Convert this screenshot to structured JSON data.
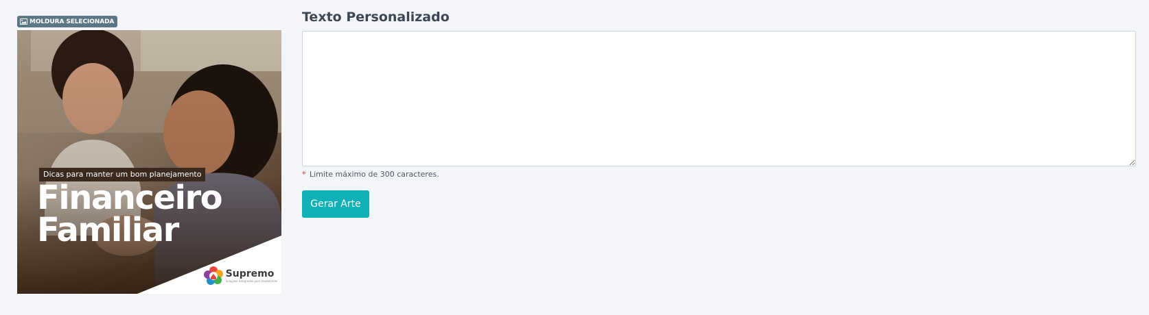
{
  "badge": {
    "label": "MOLDURA SELECIONADA",
    "icon": "image-icon"
  },
  "preview": {
    "tagline": "Dicas para manter um bom planejamento",
    "headline_line1": "Financeiro",
    "headline_line2": "Familiar",
    "brand_name": "Supremo",
    "brand_subtitle": "Soluções Integradas para Imobiliárias"
  },
  "form": {
    "title": "Texto Personalizado",
    "textarea_value": "",
    "textarea_placeholder": "",
    "hint_marker": "*",
    "hint_text": "Limite máximo de 300 caracteres.",
    "submit_label": "Gerar Arte"
  },
  "colors": {
    "badge_bg": "#5b7684",
    "button_bg": "#0fb1b6",
    "required_marker": "#e0402f",
    "page_bg": "#f4f5f9"
  }
}
